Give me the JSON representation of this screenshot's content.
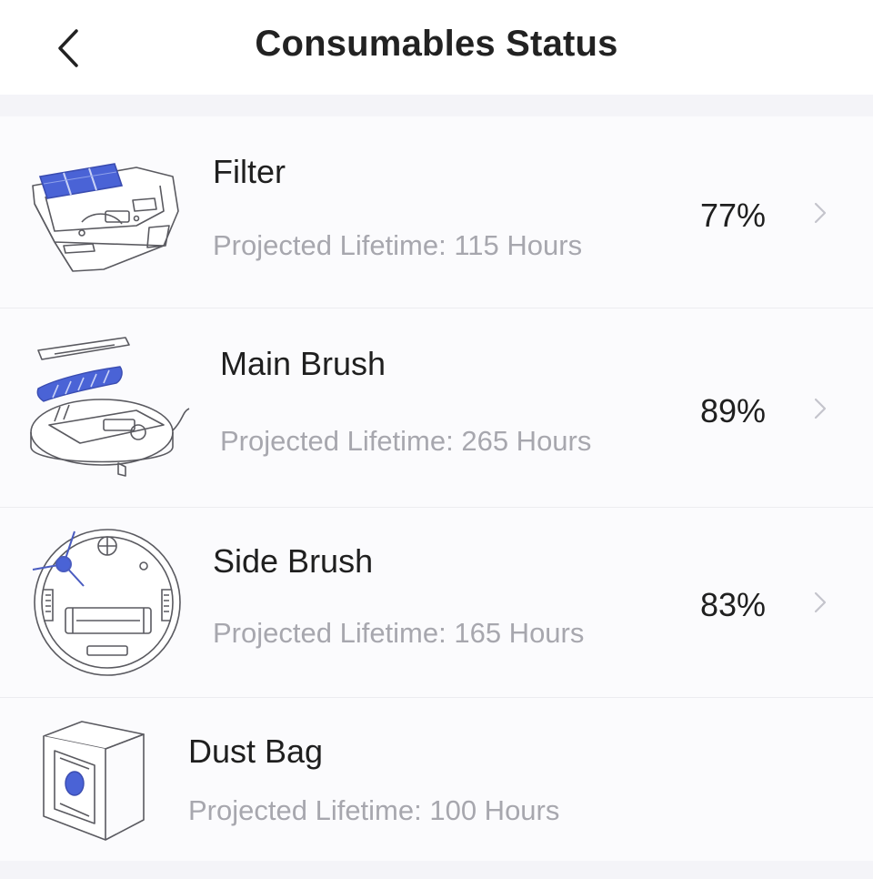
{
  "header": {
    "title": "Consumables Status",
    "back_icon": "chevron-left-icon"
  },
  "items": [
    {
      "name": "Filter",
      "lifetime": "Projected Lifetime: 115 Hours",
      "percent": "77%",
      "icon": "filter-illustration"
    },
    {
      "name": "Main Brush",
      "lifetime": "Projected Lifetime: 265 Hours",
      "percent": "89%",
      "icon": "main-brush-illustration"
    },
    {
      "name": "Side Brush",
      "lifetime": "Projected Lifetime: 165 Hours",
      "percent": "83%",
      "icon": "side-brush-illustration"
    },
    {
      "name": "Dust Bag",
      "lifetime": "Projected Lifetime: 100 Hours",
      "icon": "dust-bag-illustration"
    }
  ],
  "colors": {
    "accent_blue": "#3d55c8",
    "line": "#5a5a60",
    "muted_text": "#a7a7ae",
    "background": "#fbfbfd"
  }
}
